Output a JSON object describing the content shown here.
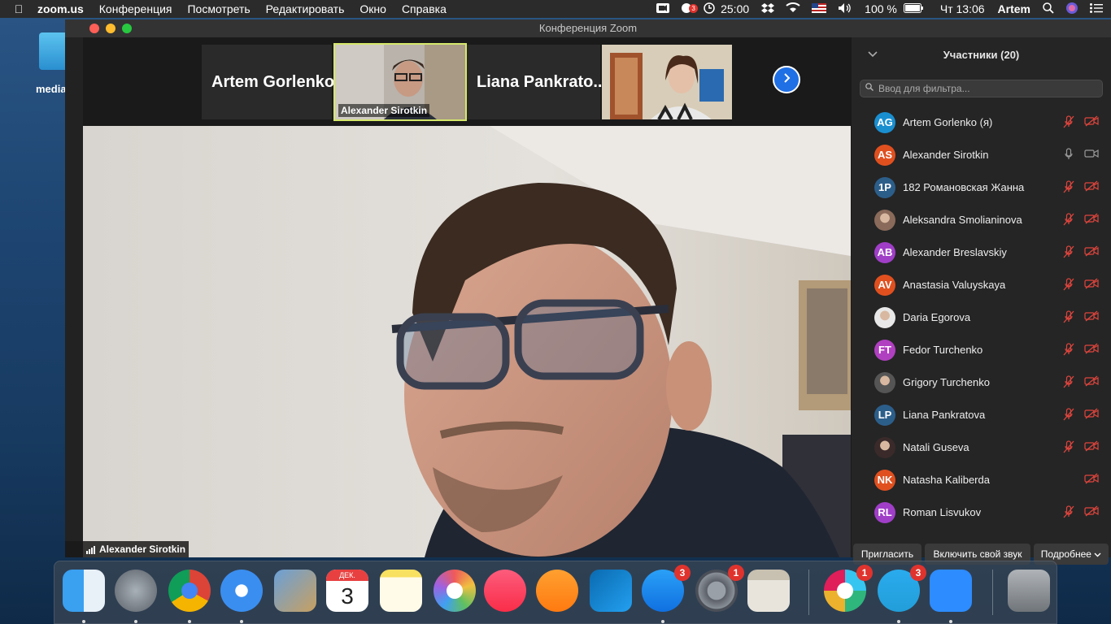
{
  "menubar": {
    "app_name": "zoom.us",
    "items": [
      "Конференция",
      "Посмотреть",
      "Редактировать",
      "Окно",
      "Справка"
    ],
    "zoom_badge": "3",
    "timer": "25:00",
    "battery": "100 %",
    "datetime": "Чт 13:06",
    "user": "Artem"
  },
  "desktop": {
    "folder_label": "media"
  },
  "window": {
    "title": "Конференция Zoom",
    "thumbnails": [
      {
        "name": "Artem Gorlenko"
      },
      {
        "name": "Alexander Sirotkin",
        "active": true
      },
      {
        "name": "Liana Pankrato..."
      },
      {
        "name": ""
      }
    ],
    "main_speaker": "Alexander Sirotkin"
  },
  "participants": {
    "title": "Участники (20)",
    "filter_placeholder": "Ввод для фильтра...",
    "list": [
      {
        "initials": "AG",
        "name": "Artem Gorlenko (я)",
        "color": "#1a8fd0",
        "muted": true,
        "video_off": true
      },
      {
        "initials": "AS",
        "name": "Alexander Sirotkin",
        "color": "#e0501f",
        "muted": false,
        "video_off": false
      },
      {
        "initials": "1P",
        "name": "182  Романовская Жанна",
        "color": "#2c5e8a",
        "muted": true,
        "video_off": true
      },
      {
        "initials": "",
        "name": "Aleksandra Smolianinova",
        "color": "#8a6a5a",
        "photo": true,
        "muted": true,
        "video_off": true
      },
      {
        "initials": "AB",
        "name": "Alexander Breslavskiy",
        "color": "#a03ec8",
        "muted": true,
        "video_off": true
      },
      {
        "initials": "AV",
        "name": "Anastasia Valuyskaya",
        "color": "#e0501f",
        "muted": true,
        "video_off": true
      },
      {
        "initials": "",
        "name": "Daria Egorova",
        "color": "#e8e8e8",
        "photo": true,
        "muted": true,
        "video_off": true
      },
      {
        "initials": "FT",
        "name": "Fedor Turchenko",
        "color": "#b040c0",
        "muted": true,
        "video_off": true
      },
      {
        "initials": "",
        "name": "Grigory Turchenko",
        "color": "#555",
        "photo": true,
        "muted": true,
        "video_off": true
      },
      {
        "initials": "LP",
        "name": "Liana Pankratova",
        "color": "#2c5e8a",
        "muted": true,
        "video_off": true
      },
      {
        "initials": "",
        "name": "Natali Guseva",
        "color": "#3a2a2a",
        "photo": true,
        "muted": true,
        "video_off": true
      },
      {
        "initials": "NK",
        "name": "Natasha Kaliberda",
        "color": "#e0501f",
        "muted": false,
        "video_off": true
      },
      {
        "initials": "RL",
        "name": "Roman Lisvukov",
        "color": "#a03ec8",
        "muted": true,
        "video_off": true
      }
    ],
    "buttons": {
      "invite": "Пригласить",
      "unmute": "Включить свой звук",
      "more": "Подробнее"
    }
  },
  "dock": {
    "calendar_month": "ДЕК.",
    "calendar_day": "3",
    "apps": [
      {
        "name": "Finder",
        "badge": ""
      },
      {
        "name": "Launchpad",
        "badge": ""
      },
      {
        "name": "Chrome",
        "badge": ""
      },
      {
        "name": "Safari",
        "badge": ""
      },
      {
        "name": "Mail",
        "badge": ""
      },
      {
        "name": "Calendar",
        "badge": ""
      },
      {
        "name": "Notes",
        "badge": ""
      },
      {
        "name": "Photos",
        "badge": ""
      },
      {
        "name": "Music",
        "badge": ""
      },
      {
        "name": "Books",
        "badge": ""
      },
      {
        "name": "VS Code",
        "badge": ""
      },
      {
        "name": "App Store",
        "badge": "3"
      },
      {
        "name": "System Preferences",
        "badge": "1"
      },
      {
        "name": "Calculator",
        "badge": ""
      },
      {
        "name": "Slack",
        "badge": "1"
      },
      {
        "name": "Telegram",
        "badge": "3"
      },
      {
        "name": "Zoom",
        "badge": ""
      },
      {
        "name": "Trash",
        "badge": ""
      }
    ]
  }
}
